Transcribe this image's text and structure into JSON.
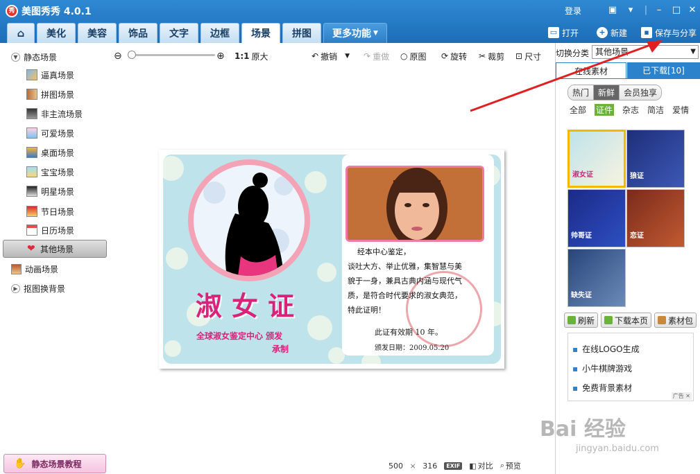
{
  "app": {
    "logo_text": "秀",
    "title": "美图秀秀 4.0.1",
    "login": "登录"
  },
  "tabs": [
    "美化",
    "美容",
    "饰品",
    "文字",
    "边框",
    "场景",
    "拼图",
    "更多功能"
  ],
  "active_tab": "场景",
  "top_actions": {
    "open": "打开",
    "new": "新建",
    "save_share": "保存与分享"
  },
  "sidebar": {
    "static_group": "静态场景",
    "items": [
      "逼真场景",
      "拼图场景",
      "非主流场景",
      "可爱场景",
      "桌面场景",
      "宝宝场景",
      "明星场景",
      "节日场景",
      "日历场景",
      "其他场景"
    ],
    "selected": "其他场景",
    "animated_group": "动画场景",
    "cutout_group": "抠图换背景",
    "tutorial_button": "静态场景教程"
  },
  "toolbar": {
    "zoom_ratio": "1:1",
    "original_size": "原大",
    "undo": "撤销",
    "redo": "重做",
    "original": "原图",
    "rotate": "旋转",
    "crop": "裁剪",
    "resize": "尺寸"
  },
  "certificate": {
    "title": "淑女证",
    "issuer": "全球淑女鉴定中心 颁发",
    "maker": "承制",
    "body_lines": [
      "经本中心鉴定，",
      "谈吐大方、举止优雅，集智慧与美",
      "貌于一身，兼具古典内涵与现代气",
      "质，是符合时代要求的淑女典范，",
      "特此证明！"
    ],
    "validity": "此证有效期 10 年。",
    "issue_date": "颁发日期：2009.05.20"
  },
  "status": {
    "width": "500",
    "times": "×",
    "height": "316",
    "exif": "EXIF",
    "compare": "对比",
    "preview": "预览"
  },
  "right_panel": {
    "category_label": "切换分类",
    "category_value": "其他场景",
    "tab_online": "在线素材",
    "tab_downloaded": "已下载[10]",
    "pills": [
      "热门",
      "新鲜",
      "会员独享"
    ],
    "active_pill": "新鲜",
    "filters": [
      "全部",
      "证件",
      "杂志",
      "简洁",
      "爱情"
    ],
    "active_filter": "证件",
    "thumb_labels": [
      "淑女证",
      "狼证",
      "帅哥证",
      "恋证",
      "缺失证"
    ],
    "refresh": "刷新",
    "download_page": "下载本页",
    "material_bag": "素材包",
    "ad_links": [
      "在线LOGO生成",
      "小牛棋牌游戏",
      "免费背景素材"
    ],
    "ad_mark": "广告"
  },
  "watermark": {
    "brand": "Bai 经验",
    "url": "jingyan.baidu.com"
  },
  "colors": {
    "title_bar": "#1c6db7",
    "accent_pink": "#d9237b",
    "arrow_red": "#e02020",
    "filter_green": "#6ab23a"
  }
}
